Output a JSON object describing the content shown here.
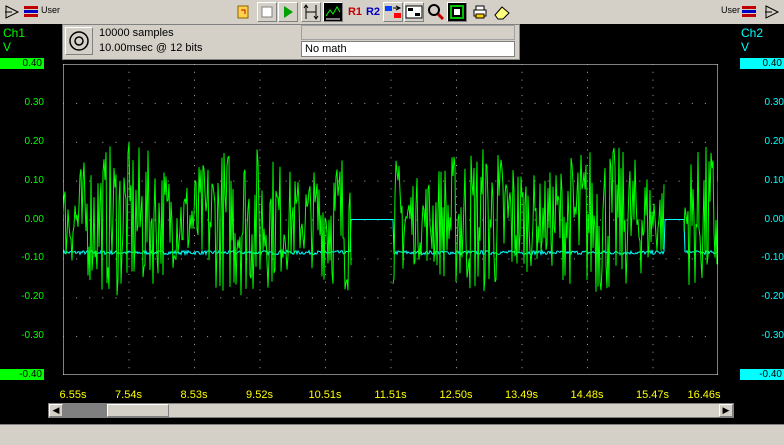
{
  "toolbar": {
    "left_user_label": "User",
    "right_user_label": "User",
    "r1_label": "R1",
    "r2_label": "R2"
  },
  "info": {
    "samples": "10000 samples",
    "timebase": "10.00msec @ 12 bits",
    "math": "No math"
  },
  "channels": {
    "ch1": {
      "name": "Ch1",
      "unit": "V",
      "color": "#00ff00"
    },
    "ch2": {
      "name": "Ch2",
      "unit": "V",
      "color": "#00ffff"
    }
  },
  "y_labels": [
    "0.40",
    "0.30",
    "0.20",
    "0.10",
    "0.00",
    "-0.10",
    "-0.20",
    "-0.30",
    "-0.40"
  ],
  "x_labels": [
    "6.55s",
    "7.54s",
    "8.53s",
    "9.52s",
    "10.51s",
    "11.51s",
    "12.50s",
    "13.49s",
    "14.48s",
    "15.47s",
    "16.46s"
  ],
  "colors": {
    "grid": "#000000",
    "time_axis": "#ffff00",
    "toolbar": "#d4d0c8"
  },
  "icons": [
    "trigger-icon",
    "stop-icon",
    "run-icon",
    "scale-icon",
    "measure-icon",
    "zoom-icon",
    "chart-icon",
    "print-icon",
    "eraser-icon",
    "circle-icon"
  ],
  "chart_data": {
    "type": "line",
    "xlim": [
      6.55,
      16.46
    ],
    "ylim": [
      -0.4,
      0.4
    ],
    "series": [
      {
        "name": "Ch1",
        "segments": [
          [
            6.55,
            10.9
          ],
          [
            11.55,
            15.65
          ],
          [
            15.95,
            16.46
          ]
        ],
        "baseline_v": 0.0,
        "amplitude_v": 0.2
      },
      {
        "name": "Ch2",
        "low_v": -0.085,
        "high_v": 0.0,
        "high_segments": [
          [
            10.9,
            11.55
          ],
          [
            15.65,
            15.95
          ]
        ]
      }
    ]
  }
}
